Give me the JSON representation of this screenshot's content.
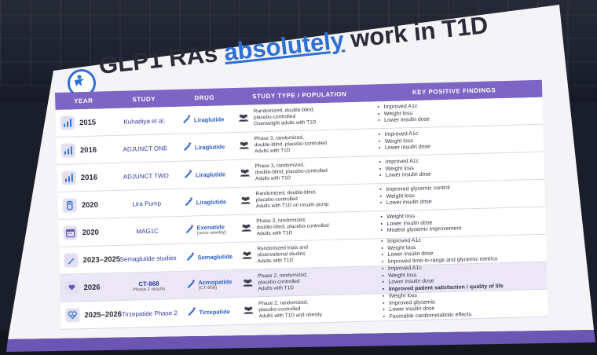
{
  "slide": {
    "title_prefix": "GLP1 RAs ",
    "title_highlight": "absolutely",
    "title_suffix": " work in T1D"
  },
  "table": {
    "headers": {
      "year": "YEAR",
      "study": "STUDY",
      "drug": "DRUG",
      "type": "STUDY TYPE / POPULATION",
      "findings": "KEY POSITIVE FINDINGS"
    },
    "rows": [
      {
        "icon": "bar-chart-icon",
        "year": "2015",
        "study": "Kuhadiya et al.",
        "drug": "Liraglutide",
        "drug_sub": "",
        "type": [
          "Randomized, double-blind,",
          "placebo-controlled",
          "Overweight adults with T1D"
        ],
        "findings": [
          "Improved A1c",
          "Weight loss",
          "Lower insulin dose"
        ]
      },
      {
        "icon": "bar-chart-icon",
        "year": "2016",
        "study": "ADJUNCT ONE",
        "drug": "Liraglutide",
        "drug_sub": "",
        "type": [
          "Phase 3, randomized,",
          "double-blind, placebo-controlled",
          "Adults with T1D"
        ],
        "findings": [
          "Improved A1c",
          "Weight loss",
          "Lower insulin dose"
        ]
      },
      {
        "icon": "bar-chart-icon",
        "year": "2016",
        "study": "ADJUNCT TWO",
        "drug": "Liraglutide",
        "drug_sub": "",
        "type": [
          "Phase 3, randomized,",
          "double-blind, placebo-controlled",
          "Adults with T1D"
        ],
        "findings": [
          "Improved A1c",
          "Weight loss",
          "Lower insulin dose"
        ]
      },
      {
        "icon": "insulin-pump-icon",
        "year": "2020",
        "study": "Lira Pump",
        "drug": "Liraglutide",
        "drug_sub": "",
        "type": [
          "Randomized, double-blind,",
          "placebo-controlled",
          "Adults with T1D on insulin pump"
        ],
        "findings": [
          "Improved glycemic control",
          "Weight loss",
          "Lower insulin dose"
        ]
      },
      {
        "icon": "calendar-icon",
        "year": "2020",
        "study": "MAG1C",
        "drug": "Exenatide",
        "drug_sub": "(once weekly)",
        "type": [
          "Phase 3, randomized,",
          "double-blind, placebo-controlled",
          "Adults with T1D"
        ],
        "findings": [
          "Weight loss",
          "Lower insulin dose",
          "Modest glycemic improvement"
        ]
      },
      {
        "icon": "pen-icon",
        "year": "2023–2025",
        "study": "Semaglutide studies",
        "drug": "Semaglutide",
        "drug_sub": "",
        "type": [
          "Randomized trials and",
          "observational studies",
          "Adults with T1D"
        ],
        "findings": [
          "Improved A1c",
          "Weight loss",
          "Lower insulin dose",
          "Improved time-in-range and glycemic metrics"
        ]
      },
      {
        "icon": "heart-hand-icon",
        "year": "2026",
        "study": "CT-868",
        "study_sub": "Phase 2 results",
        "drug": "Acmopatide",
        "drug_sub": "(CT-868)",
        "type": [
          "Phase 2, randomized,",
          "placebo-controlled",
          "Adults with T1D"
        ],
        "findings": [
          "Improved A1c",
          "Weight loss",
          "Lower insulin dose",
          "Improved patient satisfaction / quality of life"
        ],
        "highlight": true
      },
      {
        "icon": "heart-pulse-icon",
        "year": "2025–2026",
        "study": "Tirzepatide Phase 2",
        "drug": "Tirzepatide",
        "drug_sub": "",
        "type": [
          "Phase 2, randomized,",
          "placebo-controlled",
          "Adults with T1D and obesity"
        ],
        "findings": [
          "Weight loss",
          "Improved glycemia",
          "Lower insulin dose",
          "Favorable cardiometabolic effects"
        ]
      }
    ]
  },
  "colors": {
    "header_purple": "#7c65c4",
    "highlight_blue": "#2e6fd3",
    "highlight_row": "#ece7f6"
  }
}
